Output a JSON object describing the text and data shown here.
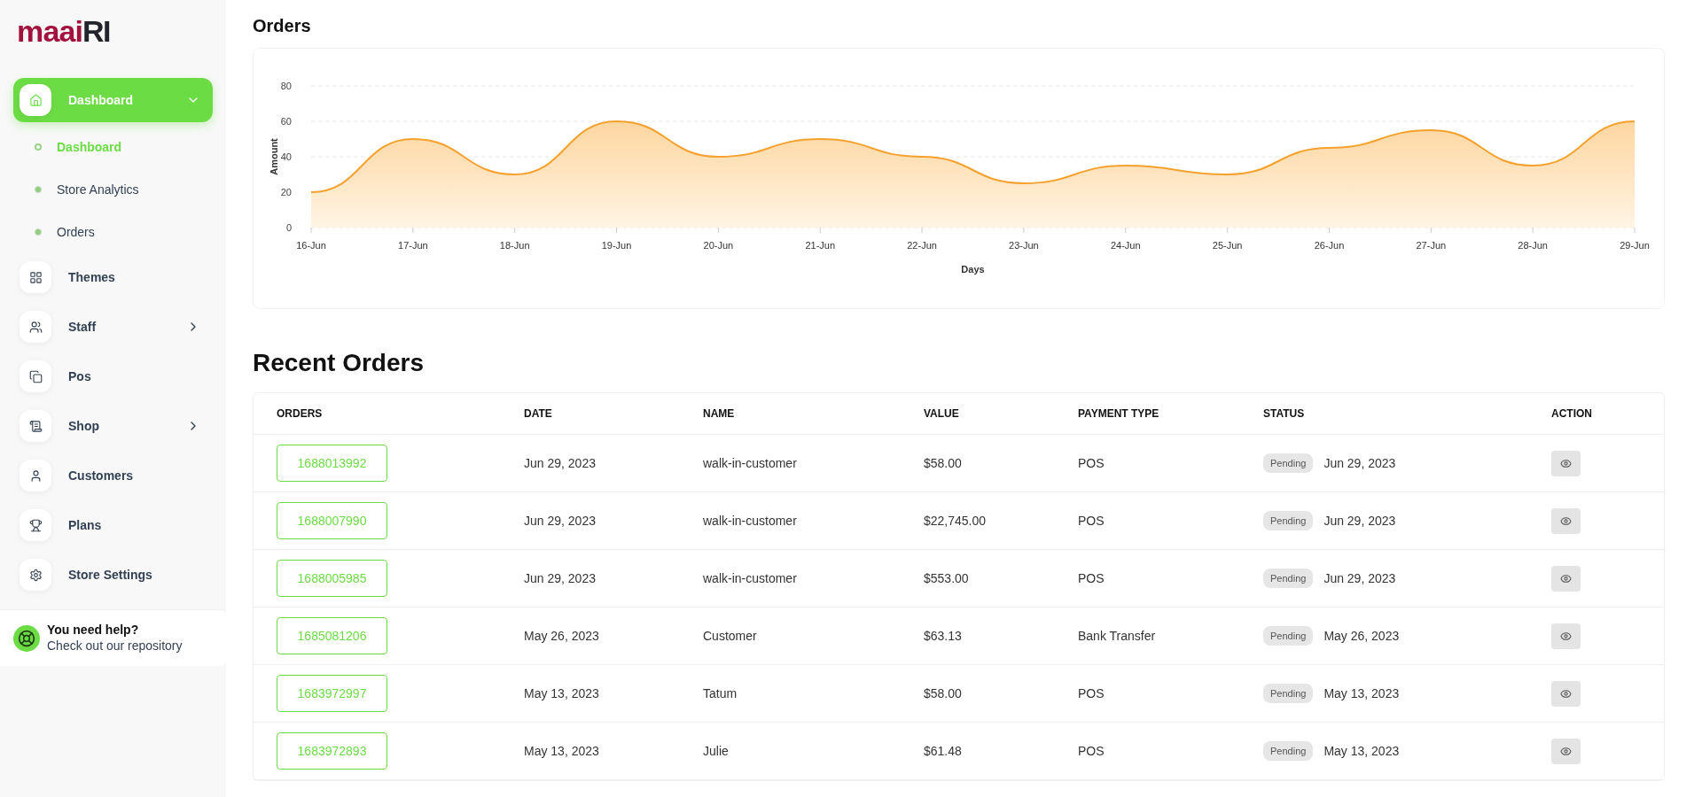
{
  "logo": {
    "part_1": "maai",
    "part_2": "RI"
  },
  "sidebar": {
    "items": [
      {
        "kind": "group",
        "label": "Dashboard",
        "selected": true,
        "expanded": true,
        "children": [
          {
            "label": "Dashboard",
            "selected": true
          },
          {
            "label": "Store Analytics",
            "selected": false
          },
          {
            "label": "Orders",
            "selected": false
          }
        ]
      },
      {
        "kind": "link",
        "label": "Themes",
        "selected": false
      },
      {
        "kind": "group",
        "label": "Staff",
        "selected": false,
        "expanded": false
      },
      {
        "kind": "link",
        "label": "Pos",
        "selected": false
      },
      {
        "kind": "group",
        "label": "Shop",
        "selected": false,
        "expanded": false
      },
      {
        "kind": "link",
        "label": "Customers",
        "selected": false
      },
      {
        "kind": "link",
        "label": "Plans",
        "selected": false
      },
      {
        "kind": "link",
        "label": "Store Settings",
        "selected": false
      }
    ],
    "help": {
      "title": "You need help?",
      "subtitle": "Check out our repository"
    }
  },
  "orders_chart": {
    "title": "Orders",
    "chart_data": {
      "type": "area",
      "xlabel": "Days",
      "ylabel": "Amount",
      "categories": [
        "16-Jun",
        "17-Jun",
        "18-Jun",
        "19-Jun",
        "20-Jun",
        "21-Jun",
        "22-Jun",
        "23-Jun",
        "24-Jun",
        "25-Jun",
        "26-Jun",
        "27-Jun",
        "28-Jun",
        "29-Jun"
      ],
      "series": [
        {
          "color": "#f5a12e",
          "values": [
            20,
            50,
            30,
            60,
            40,
            50,
            40,
            25,
            35,
            30,
            45,
            55,
            35,
            60
          ]
        }
      ],
      "ylim": [
        0,
        80
      ],
      "yticks": [
        0,
        20,
        40,
        60,
        80
      ]
    }
  },
  "recent_orders": {
    "title": "Recent Orders",
    "columns": [
      "ORDERS",
      "DATE",
      "NAME",
      "VALUE",
      "PAYMENT TYPE",
      "STATUS",
      "ACTION"
    ],
    "rows": [
      {
        "order": "1688013992",
        "date": "Jun 29, 2023",
        "name": "walk-in-customer",
        "value": "$58.00",
        "payment_type": "POS",
        "status": "Pending",
        "status_date": "Jun 29, 2023"
      },
      {
        "order": "1688007990",
        "date": "Jun 29, 2023",
        "name": "walk-in-customer",
        "value": "$22,745.00",
        "payment_type": "POS",
        "status": "Pending",
        "status_date": "Jun 29, 2023"
      },
      {
        "order": "1688005985",
        "date": "Jun 29, 2023",
        "name": "walk-in-customer",
        "value": "$553.00",
        "payment_type": "POS",
        "status": "Pending",
        "status_date": "Jun 29, 2023"
      },
      {
        "order": "1685081206",
        "date": "May 26, 2023",
        "name": "Customer",
        "value": "$63.13",
        "payment_type": "Bank Transfer",
        "status": "Pending",
        "status_date": "May 26, 2023"
      },
      {
        "order": "1683972997",
        "date": "May 13, 2023",
        "name": "Tatum",
        "value": "$58.00",
        "payment_type": "POS",
        "status": "Pending",
        "status_date": "May 13, 2023"
      },
      {
        "order": "1683972893",
        "date": "May 13, 2023",
        "name": "Julie",
        "value": "$61.48",
        "payment_type": "POS",
        "status": "Pending",
        "status_date": "May 13, 2023"
      }
    ]
  }
}
